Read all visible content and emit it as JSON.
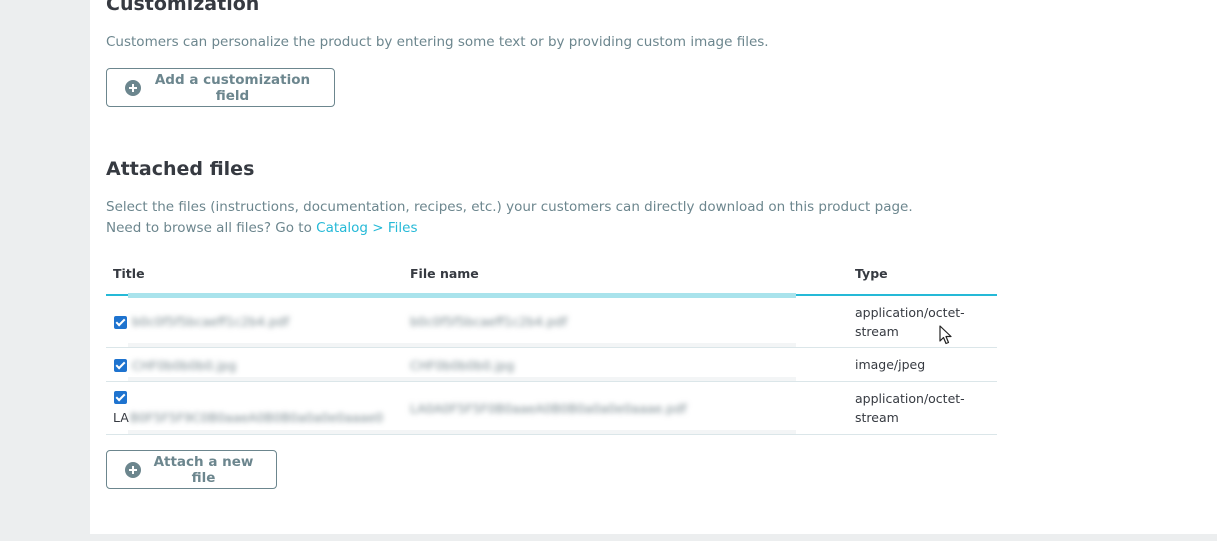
{
  "customization": {
    "title": "Customization",
    "description": "Customers can personalize the product by entering some text or by providing custom image files.",
    "add_button_label": "Add a customization field"
  },
  "attached_files": {
    "title": "Attached files",
    "description_line1": "Select the files (instructions, documentation, recipes, etc.) your customers can directly download on this product page.",
    "description_line2_prefix": "Need to browse all files? Go to ",
    "link_label": "Catalog > Files",
    "table": {
      "headers": [
        "Title",
        "File name",
        "Type"
      ],
      "rows": [
        {
          "checked": true,
          "title": "b0c0f5f5bcaeff1c2b4.pdf",
          "file_name": "b0c0f5f5bcaeff1c2b4.pdf",
          "type": "application/octet-stream"
        },
        {
          "checked": true,
          "title": "CHF0b0b0b0.jpg",
          "file_name": "CHF0b0b0b0.jpg",
          "type": "image/jpeg"
        },
        {
          "checked": true,
          "title": "LA",
          "title_blurred": "B0F5F5F9C0B0aaeA0B0B0a0a0e0aaae0",
          "file_name": "LA0A0F5F5F0B0aaeA0B0B0a0a0e0aaae.pdf",
          "type": "application/octet-stream"
        }
      ]
    },
    "attach_button_label": "Attach a new file"
  },
  "colors": {
    "text_dark": "#363a41",
    "text_muted": "#6c868e",
    "accent": "#25b9d7",
    "checkbox": "#1e73cf"
  },
  "icons": [
    "plus-circle-icon",
    "checkbox-checked-icon",
    "mouse-cursor-icon"
  ]
}
